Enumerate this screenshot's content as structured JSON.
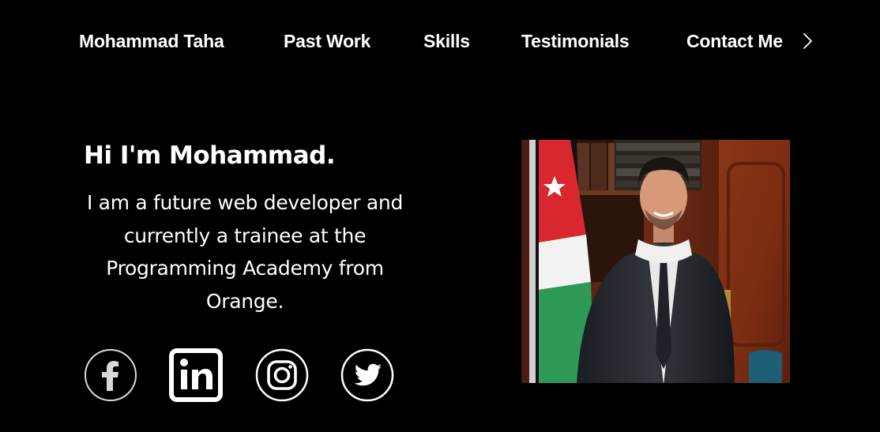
{
  "nav": {
    "items": [
      {
        "label": "Mohammad Taha"
      },
      {
        "label": "Past Work"
      },
      {
        "label": "Skills"
      },
      {
        "label": "Testimonials"
      },
      {
        "label": "Contact Me"
      }
    ],
    "more_icon": "chevron-right-icon"
  },
  "hero": {
    "title": "Hi I'm Mohammad.",
    "description": "I am a future web developer and currently a trainee at the Programming Academy from Orange."
  },
  "social": [
    {
      "name": "facebook",
      "icon": "facebook-icon"
    },
    {
      "name": "linkedin",
      "icon": "linkedin-icon"
    },
    {
      "name": "instagram",
      "icon": "instagram-icon"
    },
    {
      "name": "twitter",
      "icon": "twitter-icon"
    }
  ],
  "photo": {
    "subject": "portrait-photo"
  },
  "colors": {
    "background": "#000000",
    "text": "#ffffff",
    "facebook_ring": "#d9d9d9"
  }
}
